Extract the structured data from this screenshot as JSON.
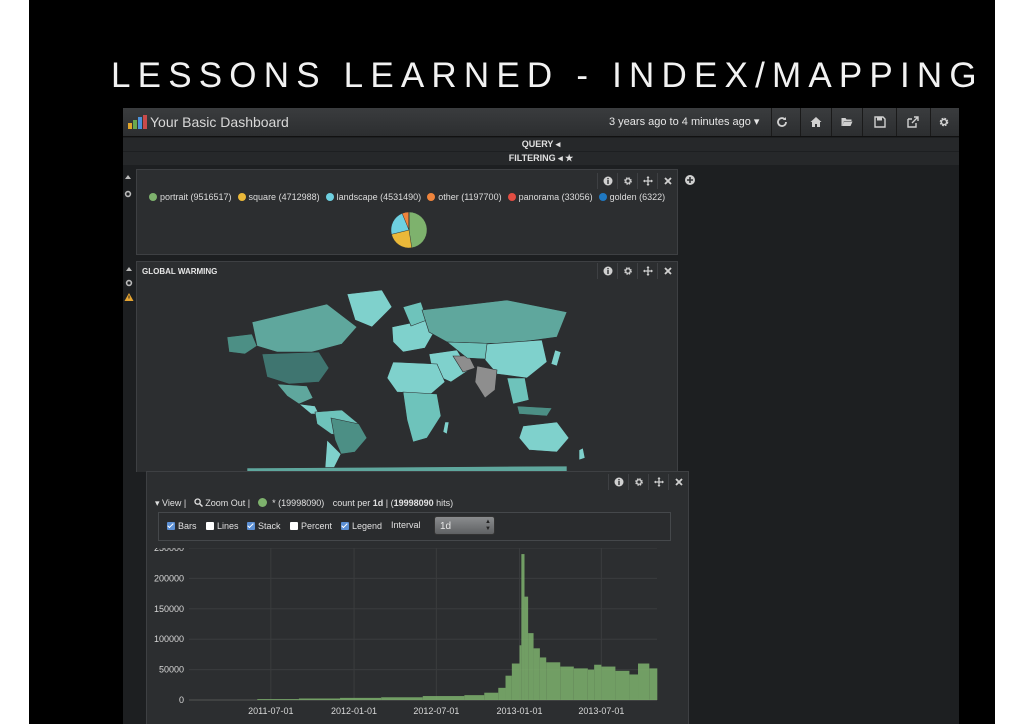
{
  "slide": {
    "title": "LESSONS LEARNED - INDEX/MAPPING"
  },
  "navbar": {
    "title": "Your Basic Dashboard",
    "time_range": "3 years ago to 4 minutes ago ▾",
    "icons": [
      "logo-icon",
      "refresh-icon",
      "home-icon",
      "folder-open-icon",
      "save-icon",
      "share-icon",
      "gear-icon"
    ]
  },
  "query_bar": {
    "label": "QUERY ◂"
  },
  "filter_bar": {
    "label": "FILTERING ◂ ★"
  },
  "pie_panel": {
    "legend": [
      {
        "label": "portrait (9516517)",
        "color": "#7eb26d",
        "value": 9516517
      },
      {
        "label": "square (4712988)",
        "color": "#eab839",
        "value": 4712988
      },
      {
        "label": "landscape (4531490)",
        "color": "#6ed0e0",
        "value": 4531490
      },
      {
        "label": "other (1197700)",
        "color": "#ef843c",
        "value": 1197700
      },
      {
        "label": "panorama (33056)",
        "color": "#e24d42",
        "value": 33056
      },
      {
        "label": "golden (6322)",
        "color": "#1f78c1",
        "value": 6322
      }
    ]
  },
  "map_panel": {
    "title": "GLOBAL WARMING"
  },
  "histogram_panel": {
    "view_label": "▾ View",
    "zoom_label": "Zoom Out",
    "series_label": "* (19998090)",
    "count_prefix": "count per ",
    "interval_bold": "1d",
    "hits_prefix": " | (",
    "hits_bold": "19998090",
    "hits_suffix": " hits)",
    "options": {
      "bars": "Bars",
      "lines": "Lines",
      "stack": "Stack",
      "percent": "Percent",
      "legend": "Legend",
      "interval_label": "Interval",
      "interval_value": "1d"
    },
    "colors": {
      "series": "#7eb26d"
    }
  },
  "chart_data": {
    "type": "bar",
    "title": "",
    "xlabel": "",
    "ylabel": "",
    "ylim": [
      0,
      250000
    ],
    "yticks": [
      "0",
      "50000",
      "100000",
      "150000",
      "200000",
      "250000"
    ],
    "xticks": [
      "2011-07-01",
      "2012-01-01",
      "2012-07-01",
      "2013-01-01",
      "2013-07-01"
    ],
    "x": [
      "2011-03-01",
      "2011-06-01",
      "2011-09-01",
      "2011-12-01",
      "2012-03-01",
      "2012-06-01",
      "2012-09-01",
      "2012-10-15",
      "2012-11-15",
      "2012-12-01",
      "2012-12-15",
      "2013-01-01",
      "2013-01-05",
      "2013-01-12",
      "2013-01-20",
      "2013-02-01",
      "2013-02-15",
      "2013-03-01",
      "2013-04-01",
      "2013-05-01",
      "2013-06-01",
      "2013-06-15",
      "2013-07-01",
      "2013-08-01",
      "2013-09-01",
      "2013-09-20",
      "2013-10-15"
    ],
    "values": [
      0,
      1500,
      2500,
      3500,
      4500,
      6500,
      8000,
      12000,
      20000,
      40000,
      60000,
      90000,
      240000,
      170000,
      110000,
      85000,
      70000,
      62000,
      55000,
      52000,
      50000,
      58000,
      55000,
      48000,
      42000,
      60000,
      52000
    ]
  }
}
